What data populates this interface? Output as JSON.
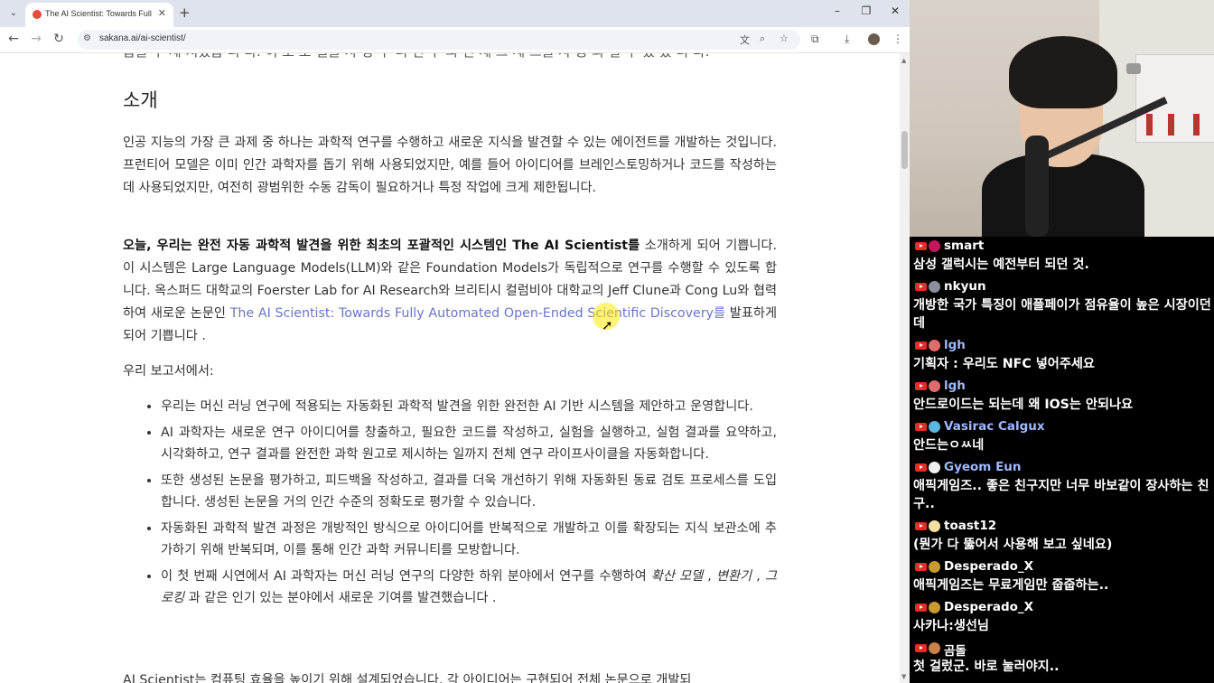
{
  "browser": {
    "tab_title": "The AI Scientist: Towards Fully",
    "url": "sakana.ai/ai-scientist/"
  },
  "article": {
    "cut_line": "습을 수 세 처었습 니 다. 이 모 모 델을 사 상 수 니 연 구 의 전 제 크 세 스를 사 동 와 할 수 있 었 니 다.",
    "heading": "소개",
    "intro_p": "인공 지능의 가장 큰 과제 중 하나는 과학적 연구를 수행하고 새로운 지식을 발견할 수 있는 에이전트를 개발하는 것입니다. 프런티어 모델은 이미 인간 과학자를 돕기 위해 사용되었지만, 예를 들어 아이디어를 브레인스토밍하거나 코드를 작성하는 데 사용되었지만, 여전히 광범위한 수동 감독이 필요하거나 특정 작업에 크게 제한됩니다.",
    "p2_bold": "오늘, 우리는 완전 자동 과학적 발견을 위한 최초의 포괄적인 시스템인 The AI Scientist를",
    "p2_text": " 소개하게 되어 기쁩니다. 이 시스템은 Large Language Models(LLM)와 같은 Foundation Models가 독립적으로 연구를 수행할 수 있도록 합니다. 옥스퍼드 대학교의 Foerster Lab for AI Research와 브리티시 컬럼비아 대학교의 Jeff Clune과 Cong Lu와 협력하여 새로운 논문인 ",
    "p2_link": "The AI Scientist: Towards Fully Automated Open-Ended Scientific Discovery를",
    "p2_end": " 발표하게 되어 기쁩니다 .",
    "report_intro": "우리 보고서에서:",
    "bullets": [
      "우리는 머신 러닝 연구에 적용되는 자동화된 과학적 발견을 위한 완전한 AI 기반 시스템을 제안하고 운영합니다.",
      "AI 과학자는 새로운 연구 아이디어를 창출하고, 필요한 코드를 작성하고, 실험을 실행하고, 실험 결과를 요약하고, 시각화하고, 연구 결과를 완전한 과학 원고로 제시하는 일까지 전체 연구 라이프사이클을 자동화합니다.",
      "또한 생성된 논문을 평가하고, 피드백을 작성하고, 결과를 더욱 개선하기 위해 자동화된 동료 검토 프로세스를 도입합니다. 생성된 논문을 거의 인간 수준의 정확도로 평가할 수 있습니다.",
      "자동화된 과학적 발견 과정은 개방적인 방식으로 아이디어를 반복적으로 개발하고 이를 확장되는 지식 보관소에 추가하기 위해 반복되며, 이를 통해 인간 과학 커뮤니티를 모방합니다."
    ],
    "bullet5_a": "이 첫 번째 시연에서 AI 과학자는 머신 러닝 연구의 다양한 하위 분야에서 연구를 수행하여 ",
    "bullet5_i1": "확산 모델",
    "bullet5_b": " , ",
    "bullet5_i2": "변환기",
    "bullet5_c": " , ",
    "bullet5_i3": "그로킹",
    "bullet5_d": " 과 같은 인기 있는 분야에서 새로운 기여를 발견했습니다 .",
    "bottom_line": "AI Scientist는 컴퓨팅 효율을 높이기 위해 설계되었습니다. 각 아이디어는 구현되어 전체 논문으로 개발되"
  },
  "chat": [
    {
      "user": "smart",
      "text": "삼성 갤럭시는 예전부터 되던 것.",
      "name_color": "#ffffff",
      "avatar_color": "#c2185b"
    },
    {
      "user": "nkyun",
      "text": "개방한 국가 특징이 애플페이가 점유율이 높은 시장이던데",
      "name_color": "#ffffff",
      "avatar_color": "#8a8f99"
    },
    {
      "user": "lgh",
      "text": "기획자 : 우리도 NFC 넣어주세요",
      "name_color": "#9fb8ff",
      "avatar_color": "#e06b6b"
    },
    {
      "user": "lgh",
      "text": "안드로이드는 되는데 왜 IOS는 안되나요",
      "name_color": "#9fb8ff",
      "avatar_color": "#e06b6b"
    },
    {
      "user": "Vasirac Calgux",
      "text": "안드는ㅇㅆ네",
      "name_color": "#9fb8ff",
      "avatar_color": "#5bb6e0"
    },
    {
      "user": "Gyeom Eun",
      "text": "애픽게임즈.. 좋은 친구지만 너무 바보같이 장사하는 친구..",
      "name_color": "#9fb8ff",
      "avatar_color": "#f0f0f0"
    },
    {
      "user": "toast12",
      "text": "(뭔가 다 뚫어서 사용해 보고 싶네요)",
      "name_color": "#ffffff",
      "avatar_color": "#f3dfa2"
    },
    {
      "user": "Desperado_X",
      "text": "애픽게임즈는 무료게임만 줍줍하는..",
      "name_color": "#ffffff",
      "avatar_color": "#c99a2e"
    },
    {
      "user": "Desperado_X",
      "text": "사카나:생선님",
      "name_color": "#ffffff",
      "avatar_color": "#c99a2e"
    },
    {
      "user": "곰돌",
      "text": "첫 걸렀군. 바로 눌러야지..",
      "name_color": "#ffffff",
      "avatar_color": "#c9824a"
    }
  ]
}
